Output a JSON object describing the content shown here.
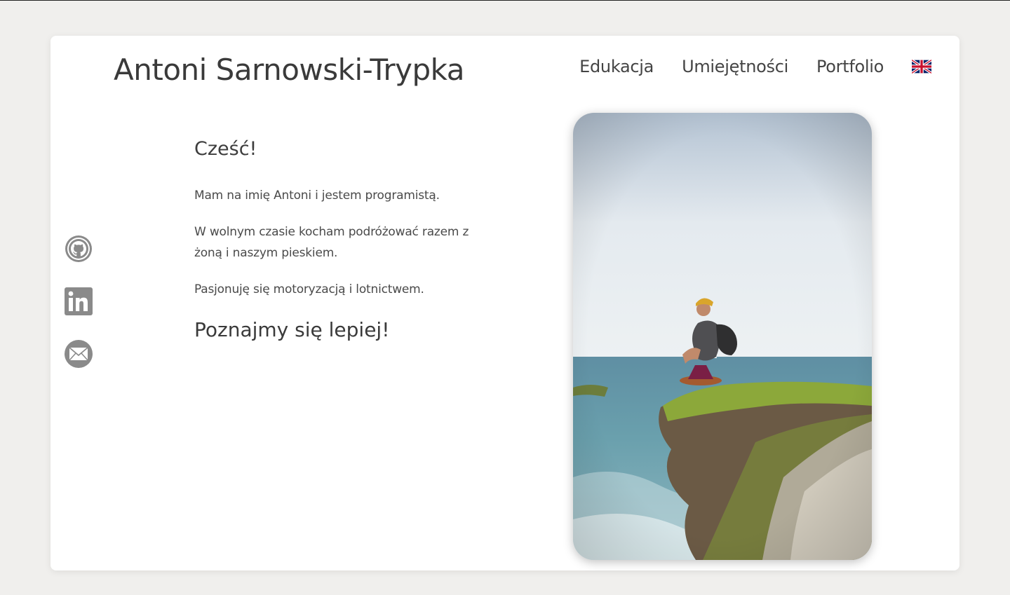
{
  "header": {
    "title": "Antoni Sarnowski-Trypka",
    "nav": [
      {
        "label": "Edukacja"
      },
      {
        "label": "Umiejętności"
      },
      {
        "label": "Portfolio"
      }
    ],
    "language_flag": "uk-flag-icon"
  },
  "social": {
    "icons": [
      "github-icon",
      "linkedin-icon",
      "email-icon"
    ],
    "icon_color": "#8a8a8a"
  },
  "main": {
    "greeting": "Cześć!",
    "paragraphs": [
      "Mam na imię Antoni i jestem programistą.",
      "W wolnym czasie kocham podróżować razem z żoną i naszym pieskiem.",
      "Pasjonuję się motoryzacją i lotnictwem."
    ],
    "cta": "Poznajmy się lepiej!"
  },
  "colors": {
    "background": "#f0efed",
    "card": "#ffffff",
    "text": "#3d3d3d"
  }
}
